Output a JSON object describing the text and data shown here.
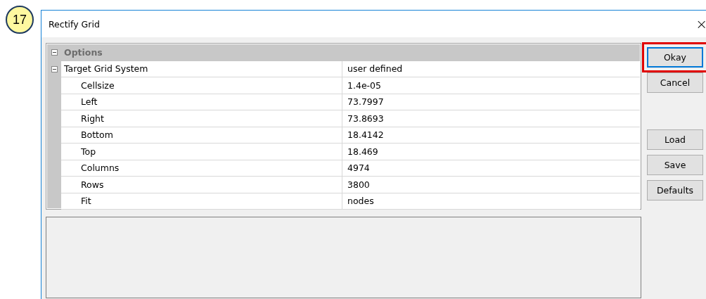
{
  "step_badge": "17",
  "window": {
    "title": "Rectify Grid",
    "close": "×"
  },
  "properties": {
    "label": "Options",
    "expanded": true,
    "children": [
      {
        "label": "Target Grid System",
        "value": "user defined",
        "expanded": true,
        "children": [
          {
            "label": "Cellsize",
            "value": "1.4e-05"
          },
          {
            "label": "Left",
            "value": "73.7997"
          },
          {
            "label": "Right",
            "value": "73.8693"
          },
          {
            "label": "Bottom",
            "value": "18.4142"
          },
          {
            "label": "Top",
            "value": "18.469"
          },
          {
            "label": "Columns",
            "value": "4974"
          },
          {
            "label": "Rows",
            "value": "3800"
          },
          {
            "label": "Fit",
            "value": "nodes"
          }
        ]
      }
    ]
  },
  "buttons": [
    {
      "label": "Okay",
      "default": true,
      "highlighted": true
    },
    {
      "label": "Cancel",
      "default": false,
      "highlighted": false
    },
    {
      "kind": "gap"
    },
    {
      "label": "Load",
      "default": false,
      "highlighted": false
    },
    {
      "label": "Save",
      "default": false,
      "highlighted": false
    },
    {
      "label": "Defaults",
      "default": false,
      "highlighted": false
    }
  ]
}
